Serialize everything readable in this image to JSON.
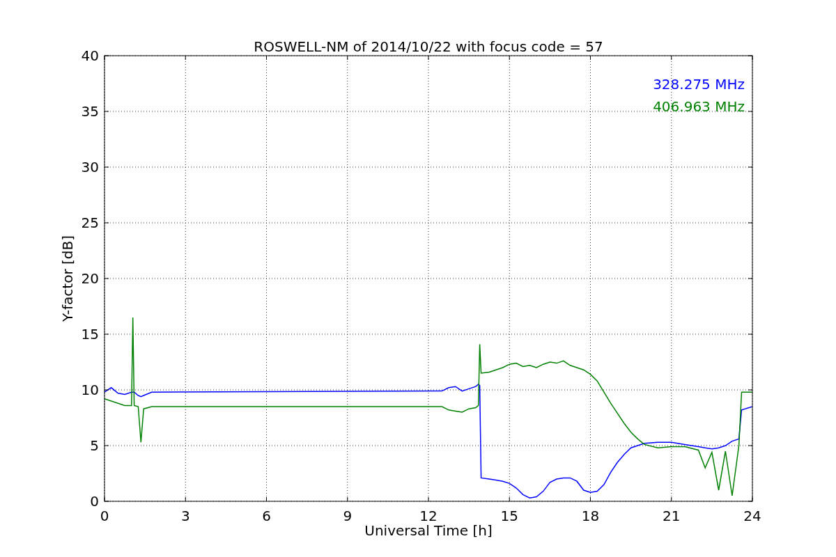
{
  "chart_data": {
    "type": "line",
    "title": "ROSWELL-NM of 2014/10/22 with focus code = 57",
    "xlabel": "Universal Time [h]",
    "ylabel": "Y-factor [dB]",
    "x": [
      0,
      0.25,
      0.5,
      0.75,
      1,
      1.05,
      1.1,
      1.25,
      1.35,
      1.45,
      1.75,
      12.5,
      12.75,
      13,
      13.25,
      13.5,
      13.75,
      13.85,
      13.9,
      13.95,
      14.25,
      14.5,
      14.75,
      15,
      15.25,
      15.5,
      15.75,
      16,
      16.25,
      16.5,
      16.75,
      17,
      17.25,
      17.5,
      17.75,
      18,
      18.25,
      18.5,
      18.75,
      19,
      19.25,
      19.5,
      19.75,
      20,
      20.5,
      21,
      21.5,
      22,
      22.25,
      22.5,
      22.75,
      23,
      23.25,
      23.5,
      23.6,
      24
    ],
    "series": [
      {
        "name": "328.275 MHz",
        "color": "#0000ff",
        "values": [
          9.8,
          10.2,
          9.7,
          9.6,
          9.8,
          9.8,
          9.8,
          9.5,
          9.4,
          9.5,
          9.8,
          9.9,
          10.2,
          10.3,
          9.9,
          10.1,
          10.3,
          10.5,
          10.4,
          2.1,
          2.0,
          1.9,
          1.8,
          1.6,
          1.2,
          0.6,
          0.3,
          0.4,
          0.9,
          1.7,
          2.0,
          2.1,
          2.1,
          1.8,
          1.0,
          0.8,
          0.9,
          1.5,
          2.6,
          3.5,
          4.2,
          4.8,
          5.0,
          5.2,
          5.3,
          5.3,
          5.1,
          4.9,
          4.8,
          4.7,
          4.8,
          5.0,
          5.4,
          5.6,
          8.2,
          8.5
        ]
      },
      {
        "name": "406.963 MHz",
        "color": "#008000",
        "values": [
          9.2,
          9.0,
          8.8,
          8.6,
          8.6,
          16.5,
          8.6,
          8.5,
          5.3,
          8.3,
          8.5,
          8.5,
          8.2,
          8.1,
          8.0,
          8.3,
          8.4,
          8.6,
          14.1,
          11.5,
          11.6,
          11.8,
          12.0,
          12.3,
          12.4,
          12.1,
          12.2,
          12.0,
          12.3,
          12.5,
          12.4,
          12.6,
          12.2,
          12.0,
          11.8,
          11.4,
          10.8,
          9.8,
          8.8,
          7.9,
          7.0,
          6.2,
          5.6,
          5.1,
          4.8,
          4.9,
          4.9,
          4.6,
          3.0,
          4.4,
          1.0,
          4.5,
          0.5,
          5.0,
          9.8,
          9.8
        ]
      }
    ],
    "xlim": [
      0,
      24
    ],
    "ylim": [
      0,
      40
    ],
    "xticks": [
      0,
      3,
      6,
      9,
      12,
      15,
      18,
      21,
      24
    ],
    "yticks": [
      0,
      5,
      10,
      15,
      20,
      25,
      30,
      35,
      40
    ],
    "grid": true
  }
}
